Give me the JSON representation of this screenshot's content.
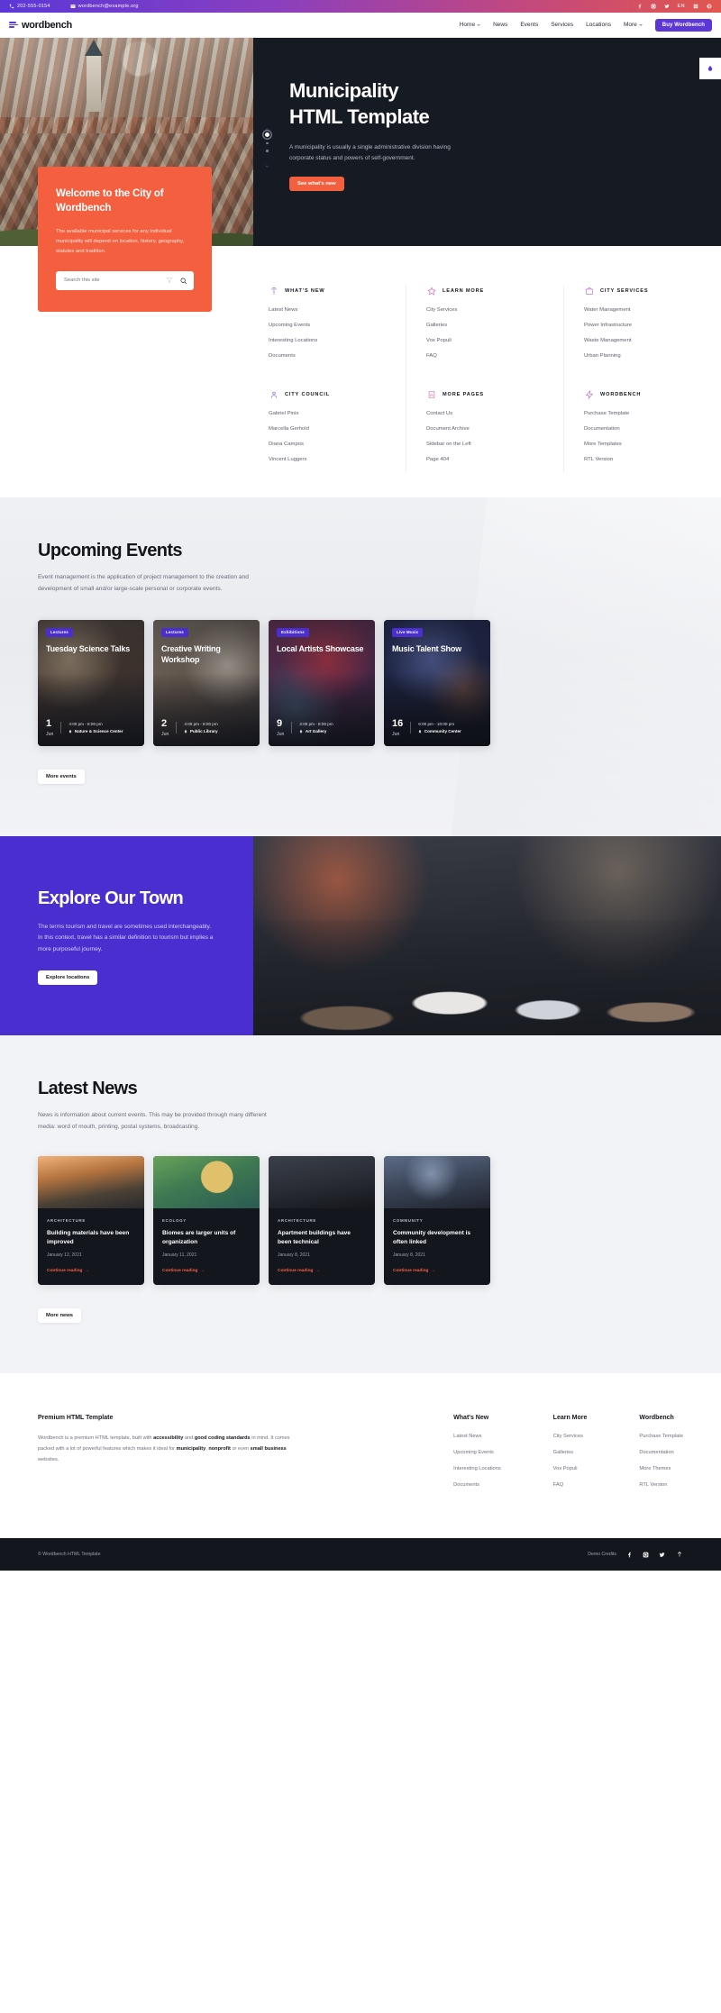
{
  "topbar": {
    "phone": "202-555-0154",
    "email": "wordbench@example.org",
    "socials": [
      "facebook-icon",
      "instagram-icon",
      "twitter-icon"
    ],
    "search_icon": "search-icon",
    "lang": "EN",
    "extra": [
      "grid-icon",
      "globe-icon"
    ]
  },
  "header": {
    "brand": "wordbench",
    "nav": [
      {
        "label": "Home",
        "has_caret": true
      },
      {
        "label": "News",
        "has_caret": false
      },
      {
        "label": "Events",
        "has_caret": false
      },
      {
        "label": "Services",
        "has_caret": false
      },
      {
        "label": "Locations",
        "has_caret": false
      },
      {
        "label": "More",
        "has_caret": true
      }
    ],
    "buy_label": "Buy Wordbench"
  },
  "hero": {
    "title_line1": "Municipality",
    "title_line2": "HTML Template",
    "subtitle": "A municipality is usually a single administrative division having corporate status and powers of self-government.",
    "cta": "See what's new",
    "slide_index": 1,
    "slide_count": 3,
    "water_icon": "water-drop-icon"
  },
  "welcome": {
    "title": "Welcome to the City of Wordbench",
    "body": "The available municipal services for any individual municipality will depend on location, history, geography, statutes and tradition.",
    "search_placeholder": "Search this site",
    "search_value": "",
    "filter_icon": "filter-icon",
    "search_icon": "search-icon"
  },
  "mega": {
    "columns": [
      {
        "groups": [
          {
            "icon": "broadcast-icon",
            "title": "WHAT'S NEW",
            "links": [
              "Latest News",
              "Upcoming Events",
              "Interesting Locations",
              "Documents"
            ]
          },
          {
            "icon": "user-icon",
            "title": "CITY COUNCIL",
            "links": [
              "Gabriel Pinis",
              "Marcella Gerhold",
              "Diana Campos",
              "Vincent Luggers"
            ]
          }
        ]
      },
      {
        "groups": [
          {
            "icon": "star-icon",
            "title": "LEARN MORE",
            "links": [
              "City Services",
              "Galleries",
              "Vox Populi",
              "FAQ"
            ]
          },
          {
            "icon": "chart-icon",
            "title": "MORE PAGES",
            "links": [
              "Contact Us",
              "Document Archive",
              "Sidebar on the Left",
              "Page 404"
            ]
          }
        ]
      },
      {
        "groups": [
          {
            "icon": "briefcase-icon",
            "title": "CITY SERVICES",
            "links": [
              "Water Management",
              "Power Infrastructure",
              "Waste Management",
              "Urban Planning"
            ]
          },
          {
            "icon": "bolt-icon",
            "title": "WORDBENCH",
            "links": [
              "Purchase Template",
              "Documentation",
              "More Templates",
              "RTL Version"
            ]
          }
        ]
      }
    ]
  },
  "events": {
    "title": "Upcoming Events",
    "subtitle": "Event management is the application of project management to the creation and development of small and/or large-scale personal or corporate events.",
    "more_label": "More events",
    "cards": [
      {
        "badge": "Lectures",
        "title": "Tuesday Science Talks",
        "day": "1",
        "month": "Jun",
        "time": "4:00 pm - 8:00 pm",
        "place": "Nature & Science Center"
      },
      {
        "badge": "Lectures",
        "title": "Creative Writing Workshop",
        "day": "2",
        "month": "Jun",
        "time": "4:00 pm - 8:00 pm",
        "place": "Public Library"
      },
      {
        "badge": "Exhibitions",
        "title": "Local Artists Showcase",
        "day": "9",
        "month": "Jun",
        "time": "2:00 pm - 8:00 pm",
        "place": "Art Gallery"
      },
      {
        "badge": "Live Music",
        "title": "Music Talent Show",
        "day": "16",
        "month": "Jun",
        "time": "6:00 pm - 10:00 pm",
        "place": "Community Center"
      }
    ]
  },
  "explore": {
    "title": "Explore Our Town",
    "body": "The terms tourism and travel are sometimes used interchangeably. In this context, travel has a similar definition to tourism but implies a more purposeful journey.",
    "cta": "Explore locations"
  },
  "news": {
    "title": "Latest News",
    "subtitle": "News is information about current events. This may be provided through many different media: word of mouth, printing, postal systems, broadcasting.",
    "more_label": "More news",
    "read_more": "Continue reading",
    "cards": [
      {
        "category": "ARCHITECTURE",
        "title": "Building materials have been improved",
        "date": "January 12, 2021"
      },
      {
        "category": "ECOLOGY",
        "title": "Biomes are larger units of organization",
        "date": "January 11, 2021"
      },
      {
        "category": "ARCHITECTURE",
        "title": "Apartment buildings have been technical",
        "date": "January 8, 2021"
      },
      {
        "category": "COMMUNITY",
        "title": "Community development is often linked",
        "date": "January 8, 2021"
      }
    ]
  },
  "footer": {
    "about_title": "Premium HTML Template",
    "about_body_1": "Wordbench is a premium HTML template, built with ",
    "about_b1": "accessibility",
    "about_body_2": " and ",
    "about_b2": "good coding standards",
    "about_body_3": " in mind. It comes packed with a lot of powerful features which makes it ideal for ",
    "about_b3": "municipality",
    "about_body_4": ", ",
    "about_b4": "nonprofit",
    "about_body_5": " or even ",
    "about_b5": "small business",
    "about_body_6": " websites.",
    "columns": [
      {
        "title": "What's New",
        "links": [
          "Latest News",
          "Upcoming Events",
          "Interesting Locations",
          "Documents"
        ]
      },
      {
        "title": "Learn More",
        "links": [
          "City Services",
          "Galleries",
          "Vox Populi",
          "FAQ"
        ]
      },
      {
        "title": "Wordbench",
        "links": [
          "Purchase Template",
          "Documentation",
          "More Themes",
          "RTL Version"
        ]
      }
    ],
    "copyright": "© Wordbench HTML Template",
    "credits": "Demo Credits",
    "socials": [
      "facebook-icon",
      "instagram-icon",
      "twitter-icon"
    ],
    "back_to_top": "back-to-top-icon"
  },
  "colors": {
    "brand_purple": "#5b37d8",
    "accent_orange": "#f4603f",
    "dark": "#14161e",
    "explore_purple": "#4b2ed0"
  }
}
